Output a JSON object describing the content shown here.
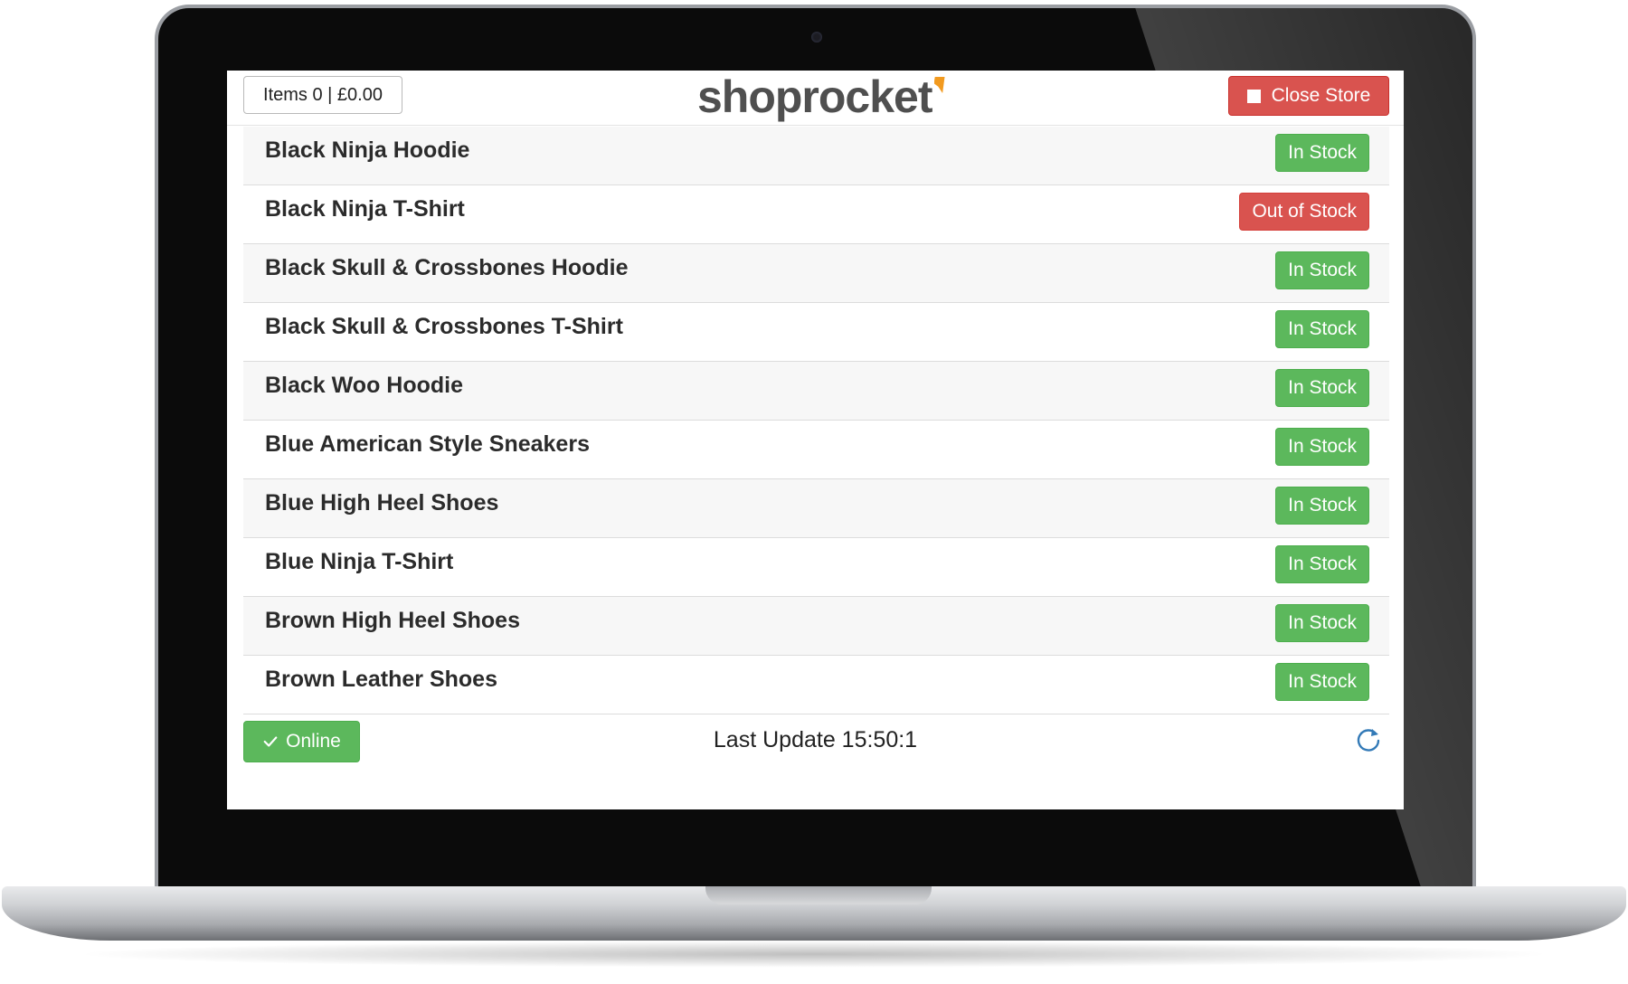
{
  "header": {
    "cart_summary": "Items 0 | £0.00",
    "logo_text": "shoprocket",
    "close_store_label": "Close Store"
  },
  "products": [
    {
      "name": "Black Ninja Hoodie",
      "status": "In Stock"
    },
    {
      "name": "Black Ninja T-Shirt",
      "status": "Out of Stock"
    },
    {
      "name": "Black Skull & Crossbones Hoodie",
      "status": "In Stock"
    },
    {
      "name": "Black Skull & Crossbones T-Shirt",
      "status": "In Stock"
    },
    {
      "name": "Black Woo Hoodie",
      "status": "In Stock"
    },
    {
      "name": "Blue American Style Sneakers",
      "status": "In Stock"
    },
    {
      "name": "Blue High Heel Shoes",
      "status": "In Stock"
    },
    {
      "name": "Blue Ninja T-Shirt",
      "status": "In Stock"
    },
    {
      "name": "Brown High Heel Shoes",
      "status": "In Stock"
    },
    {
      "name": "Brown Leather Shoes",
      "status": "In Stock"
    }
  ],
  "footer": {
    "online_label": "Online",
    "last_update": "Last Update 15:50:1"
  },
  "icons": {
    "close_store": "stop-square-icon",
    "online": "checkmark-icon",
    "refresh": "refresh-icon"
  },
  "colors": {
    "in_stock": "#5cb85c",
    "out_of_stock": "#d9534f",
    "close_store": "#d9534f",
    "logo_accent": "#f29a1f"
  }
}
